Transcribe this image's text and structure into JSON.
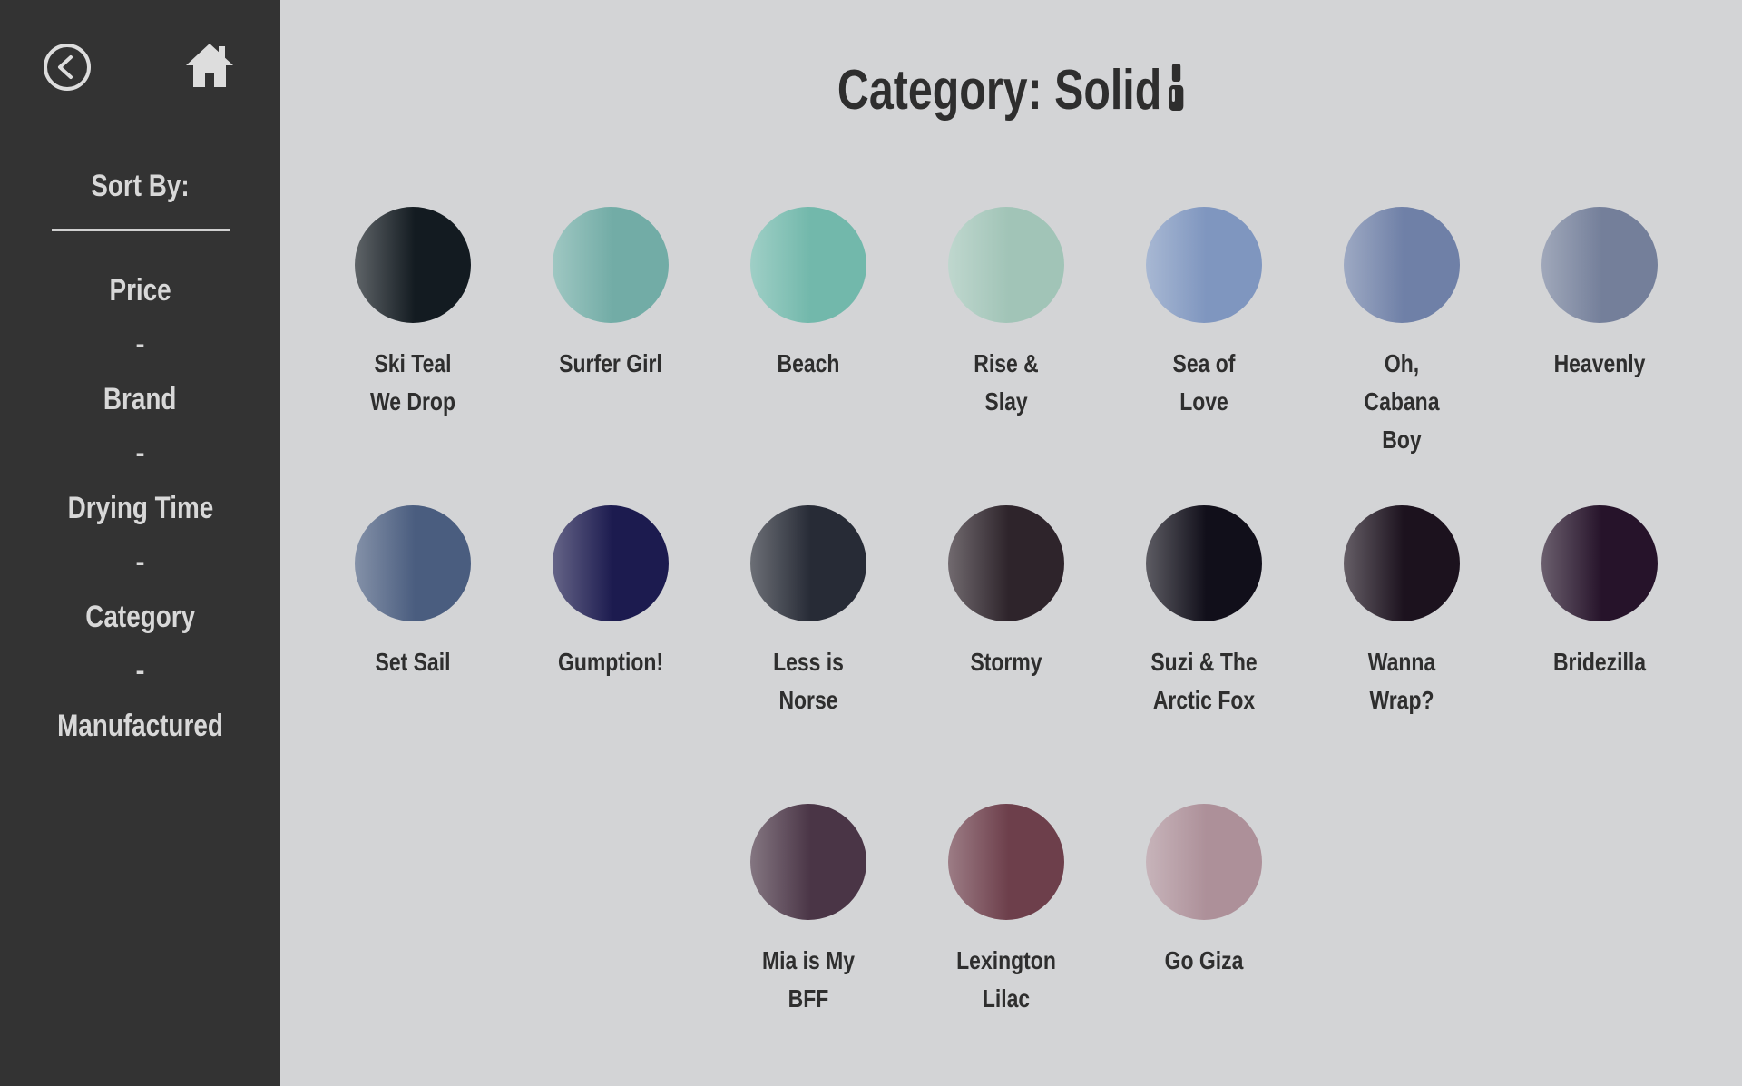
{
  "sidebar": {
    "back_icon": "back-arrow-circle-icon",
    "home_icon": "home-icon",
    "sort_title": "Sort By:",
    "items": [
      "Price",
      "Brand",
      "Drying Time",
      "Category",
      "Manufactured"
    ],
    "separator": "-"
  },
  "header": {
    "title": "Category: Solid",
    "title_icon": "nail-polish-bottle-icon"
  },
  "swatches": [
    {
      "name": "Ski Teal We Drop",
      "color": "#131b21"
    },
    {
      "name": "Surfer Girl",
      "color": "#72aca6"
    },
    {
      "name": "Beach",
      "color": "#72b8ab"
    },
    {
      "name": "Rise & Slay",
      "color": "#a1c4b7"
    },
    {
      "name": "Sea of Love",
      "color": "#7f96bf"
    },
    {
      "name": "Oh, Cabana Boy",
      "color": "#6f80a7"
    },
    {
      "name": "Heavenly",
      "color": "#747f9a"
    },
    {
      "name": "Set Sail",
      "color": "#4a5d7f"
    },
    {
      "name": "Gumption!",
      "color": "#1c1b4f"
    },
    {
      "name": "Less is Norse",
      "color": "#272b36"
    },
    {
      "name": "Stormy",
      "color": "#2e242b"
    },
    {
      "name": "Suzi & The Arctic Fox",
      "color": "#110f1a"
    },
    {
      "name": "Wanna Wrap?",
      "color": "#1c121e"
    },
    {
      "name": "Bridezilla",
      "color": "#26132a"
    },
    {
      "name": "Mia is My BFF",
      "color": "#4a3546"
    },
    {
      "name": "Lexington Lilac",
      "color": "#6d3f4b"
    },
    {
      "name": "Go Giza",
      "color": "#ad9099"
    }
  ]
}
